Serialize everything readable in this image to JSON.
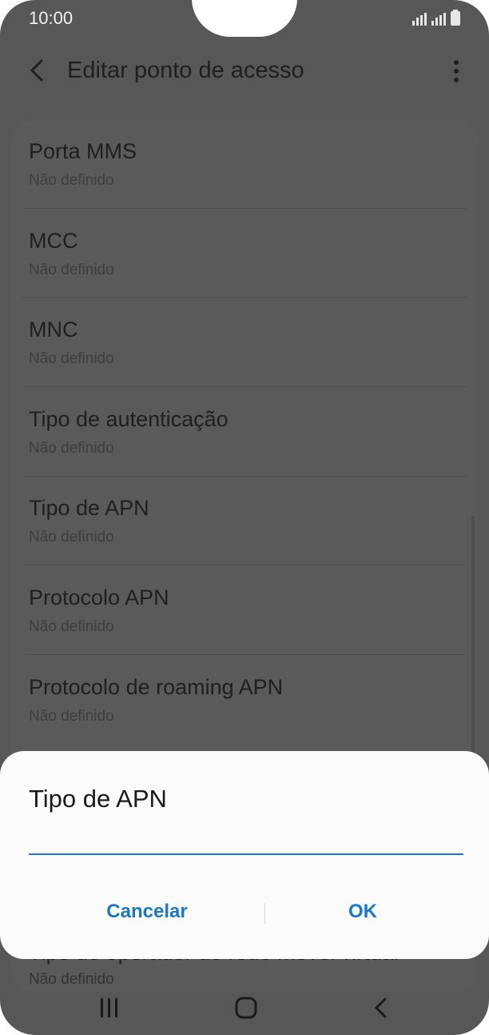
{
  "status_bar": {
    "time": "10:00"
  },
  "app_bar": {
    "title": "Editar ponto de acesso"
  },
  "settings": [
    {
      "title": "Porta MMS",
      "value": "Não definido"
    },
    {
      "title": "MCC",
      "value": "Não definido"
    },
    {
      "title": "MNC",
      "value": "Não definido"
    },
    {
      "title": "Tipo de autenticação",
      "value": "Não definido"
    },
    {
      "title": "Tipo de APN",
      "value": "Não definido"
    },
    {
      "title": "Protocolo APN",
      "value": "Não definido"
    },
    {
      "title": "Protocolo de roaming APN",
      "value": "Não definido"
    }
  ],
  "peek_item": {
    "title": "Tipo de operador de rede móvel virtual",
    "value": "Não definido"
  },
  "dialog": {
    "title": "Tipo de APN",
    "input_value": "",
    "cancel_label": "Cancelar",
    "ok_label": "OK"
  },
  "colors": {
    "accent": "#1b78c8",
    "scrim": "#575757",
    "dialog_bg": "#fbfbfb"
  }
}
